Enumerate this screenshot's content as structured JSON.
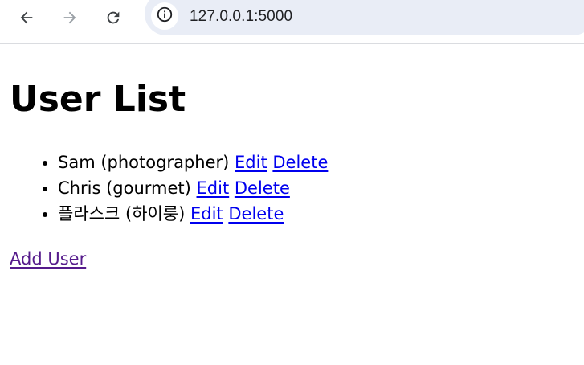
{
  "browser": {
    "url": "127.0.0.1:5000",
    "icons": {
      "back": "arrow-left-icon",
      "forward": "arrow-right-icon",
      "reload": "reload-icon",
      "site_info": "info-icon"
    },
    "forward_enabled": false
  },
  "page": {
    "title": "User List",
    "users": [
      {
        "name": "Sam",
        "role": "photographer",
        "edit_label": "Edit",
        "delete_label": "Delete"
      },
      {
        "name": "Chris",
        "role": "gourmet",
        "edit_label": "Edit",
        "delete_label": "Delete"
      },
      {
        "name": "플라스크",
        "role": "하이룽",
        "edit_label": "Edit",
        "delete_label": "Delete"
      }
    ],
    "add_user_label": "Add User"
  },
  "colors": {
    "link": "#0000ee",
    "visited_link": "#551a8b",
    "omnibox_bg": "#e9edf6"
  }
}
